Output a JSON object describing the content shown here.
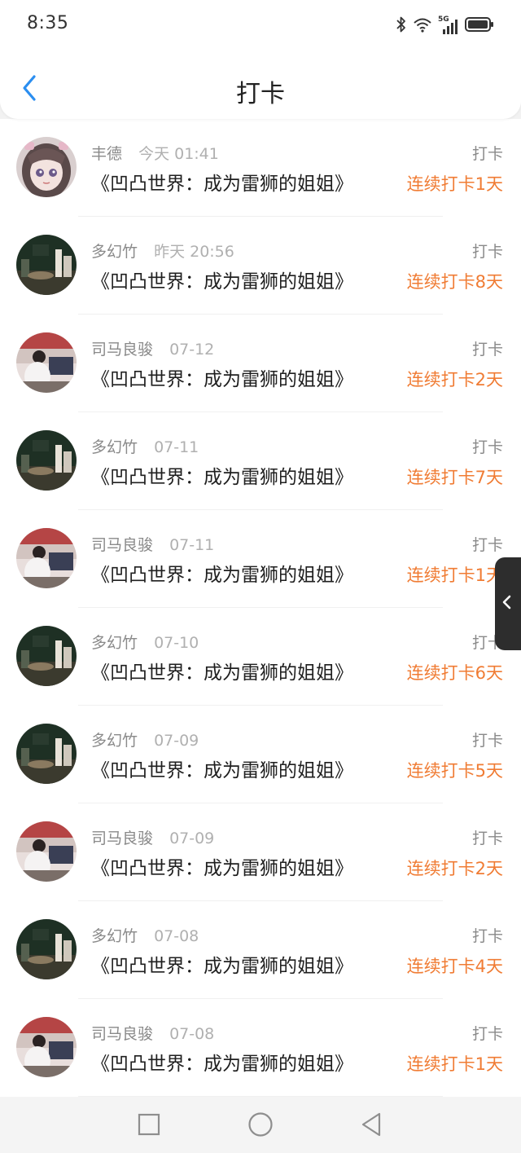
{
  "status_bar": {
    "time": "8:35",
    "icons": [
      "bluetooth-icon",
      "wifi-icon",
      "signal-5g-icon",
      "battery-icon"
    ],
    "network_label": "5G"
  },
  "header": {
    "title": "打卡",
    "back_icon": "chevron-left-icon",
    "back_color": "#2b8ef0"
  },
  "colors": {
    "accent_orange": "#f07c34",
    "muted_text": "#8a8a8a"
  },
  "items": [
    {
      "user": "丰德",
      "time": "今天 01:41",
      "book": "《凹凸世界：成为雷狮的姐姐》",
      "action": "打卡",
      "streak": "连续打卡1天",
      "avatar": "anime-girl"
    },
    {
      "user": "多幻竹",
      "time": "昨天 20:56",
      "book": "《凹凸世界：成为雷狮的姐姐》",
      "action": "打卡",
      "streak": "连续打卡8天",
      "avatar": "dark-photo"
    },
    {
      "user": "司马良骏",
      "time": "07-12",
      "book": "《凹凸世界：成为雷狮的姐姐》",
      "action": "打卡",
      "streak": "连续打卡2天",
      "avatar": "classroom"
    },
    {
      "user": "多幻竹",
      "time": "07-11",
      "book": "《凹凸世界：成为雷狮的姐姐》",
      "action": "打卡",
      "streak": "连续打卡7天",
      "avatar": "dark-photo"
    },
    {
      "user": "司马良骏",
      "time": "07-11",
      "book": "《凹凸世界：成为雷狮的姐姐》",
      "action": "打卡",
      "streak": "连续打卡1天",
      "avatar": "classroom"
    },
    {
      "user": "多幻竹",
      "time": "07-10",
      "book": "《凹凸世界：成为雷狮的姐姐》",
      "action": "打卡",
      "streak": "连续打卡6天",
      "avatar": "dark-photo"
    },
    {
      "user": "多幻竹",
      "time": "07-09",
      "book": "《凹凸世界：成为雷狮的姐姐》",
      "action": "打卡",
      "streak": "连续打卡5天",
      "avatar": "dark-photo"
    },
    {
      "user": "司马良骏",
      "time": "07-09",
      "book": "《凹凸世界：成为雷狮的姐姐》",
      "action": "打卡",
      "streak": "连续打卡2天",
      "avatar": "classroom"
    },
    {
      "user": "多幻竹",
      "time": "07-08",
      "book": "《凹凸世界：成为雷狮的姐姐》",
      "action": "打卡",
      "streak": "连续打卡4天",
      "avatar": "dark-photo"
    },
    {
      "user": "司马良骏",
      "time": "07-08",
      "book": "《凹凸世界：成为雷狮的姐姐》",
      "action": "打卡",
      "streak": "连续打卡1天",
      "avatar": "classroom"
    }
  ],
  "side_handle": {
    "icon": "chevron-left-icon"
  },
  "system_nav": {
    "buttons": [
      "recent-apps-square-icon",
      "home-circle-icon",
      "back-triangle-icon"
    ]
  }
}
